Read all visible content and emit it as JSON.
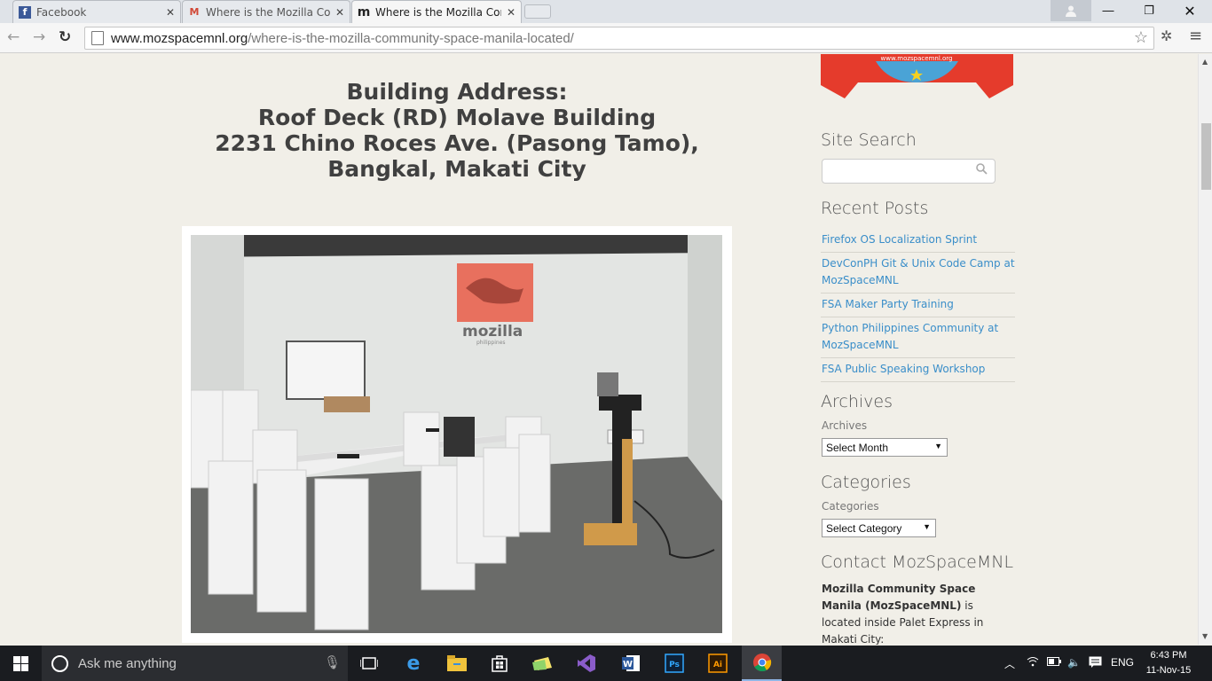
{
  "browser": {
    "tabs": [
      {
        "title": "Facebook"
      },
      {
        "title": "Where is the Mozilla Com"
      },
      {
        "title": "Where is the Mozilla Com"
      }
    ],
    "url_host": "www.mozspacemnl.org",
    "url_path": "/where-is-the-mozilla-community-space-manila-located/"
  },
  "article": {
    "address_line1": "Building Address:",
    "address_line2": "Roof Deck (RD) Molave Building",
    "address_line3": "2231 Chino Roces Ave. (Pasong Tamo),",
    "address_line4": "Bangkal, Makati City",
    "photo_logo": "mozilla",
    "photo_logo_sub": "philippines"
  },
  "sidebar": {
    "ribbon_text": "www.mozspacemnl.org",
    "site_search_title": "Site Search",
    "recent_posts_title": "Recent Posts",
    "recent_posts": [
      "Firefox OS Localization Sprint",
      "DevConPH Git & Unix Code Camp at MozSpaceMNL",
      "FSA Maker Party Training",
      "Python Philippines Community at MozSpaceMNL",
      "FSA Public Speaking Workshop"
    ],
    "archives_title": "Archives",
    "archives_label": "Archives",
    "archives_select": "Select Month",
    "categories_title": "Categories",
    "categories_label": "Categories",
    "categories_select": "Select Category",
    "contact_title": "Contact MozSpaceMNL",
    "contact_bold": "Mozilla Community Space Manila (MozSpaceMNL)",
    "contact_rest": " is located inside Palet Express in Makati City:"
  },
  "taskbar": {
    "search_placeholder": "Ask me anything",
    "language": "ENG",
    "time": "6:43 PM",
    "date": "11-Nov-15"
  },
  "colors": {
    "page_bg": "#f1efe8",
    "link": "#3a8ec9",
    "heading": "#404040",
    "taskbar": "#1a1c20"
  }
}
